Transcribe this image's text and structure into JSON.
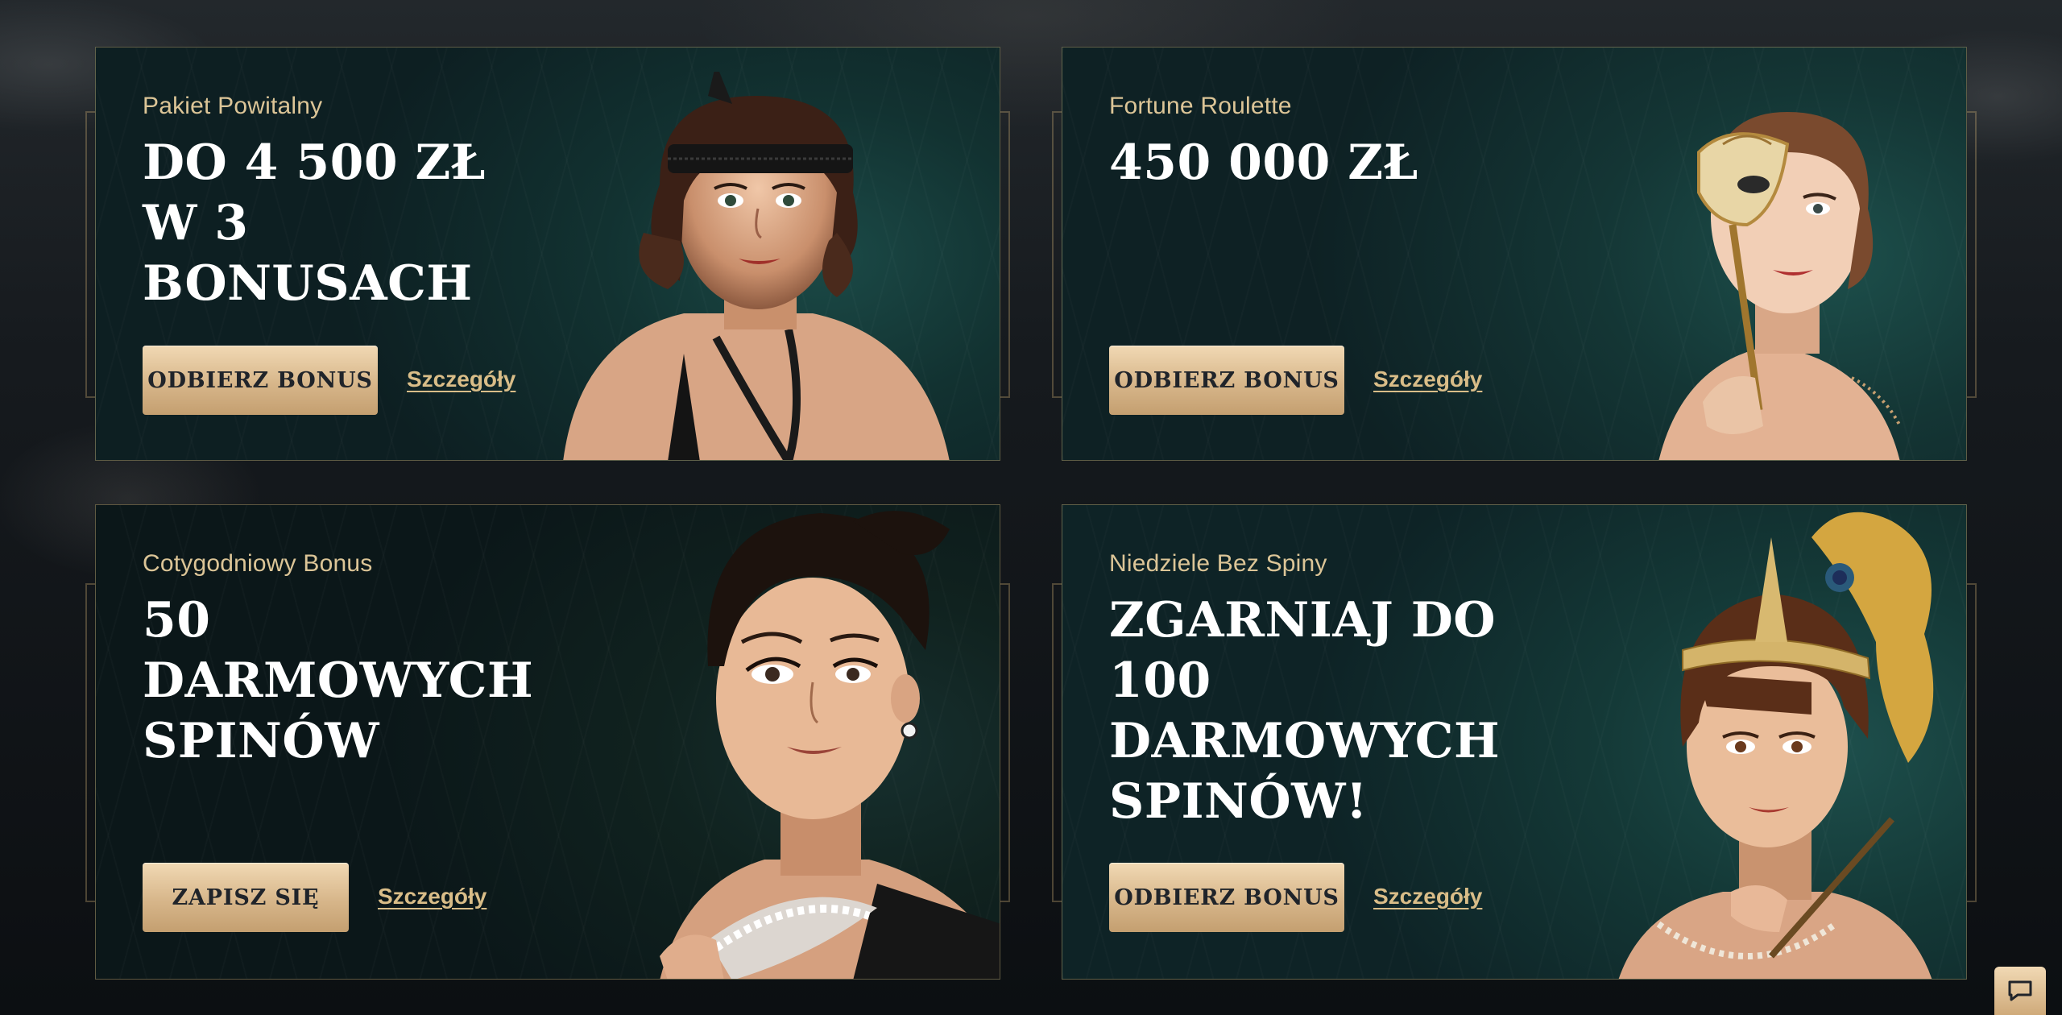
{
  "colors": {
    "accent_gold": "#dcc597",
    "button_gold": "#d7b68a",
    "card_teal": "#143635",
    "background": "#0d1114"
  },
  "promos": [
    {
      "subtitle": "Pakiet Powitalny",
      "title": "DO 4 500 ZŁ\nW 3\nBONUSACH",
      "button": "ODBIERZ BONUS",
      "link": "Szczegóły",
      "portrait": "woman-with-beaded-headband"
    },
    {
      "subtitle": "Fortune Roulette",
      "title": "450 000 ZŁ",
      "button": "ODBIERZ BONUS",
      "link": "Szczegóły",
      "portrait": "woman-with-venetian-mask"
    },
    {
      "subtitle": "Cotygodniowy Bonus",
      "title": "50\nDARMOWYCH\nSPINÓW",
      "button": "ZAPISZ SIĘ",
      "link": "Szczegóły",
      "portrait": "woman-with-pearl-necklace"
    },
    {
      "subtitle": "Niedziele Bez Spiny",
      "title": "ZGARNIAJ DO\n100\nDARMOWYCH\nSPINÓW!",
      "button": "ODBIERZ BONUS",
      "link": "Szczegóły",
      "portrait": "woman-with-peacock-feather-headpiece"
    }
  ],
  "chat": {
    "icon": "chat-bubble-icon"
  }
}
